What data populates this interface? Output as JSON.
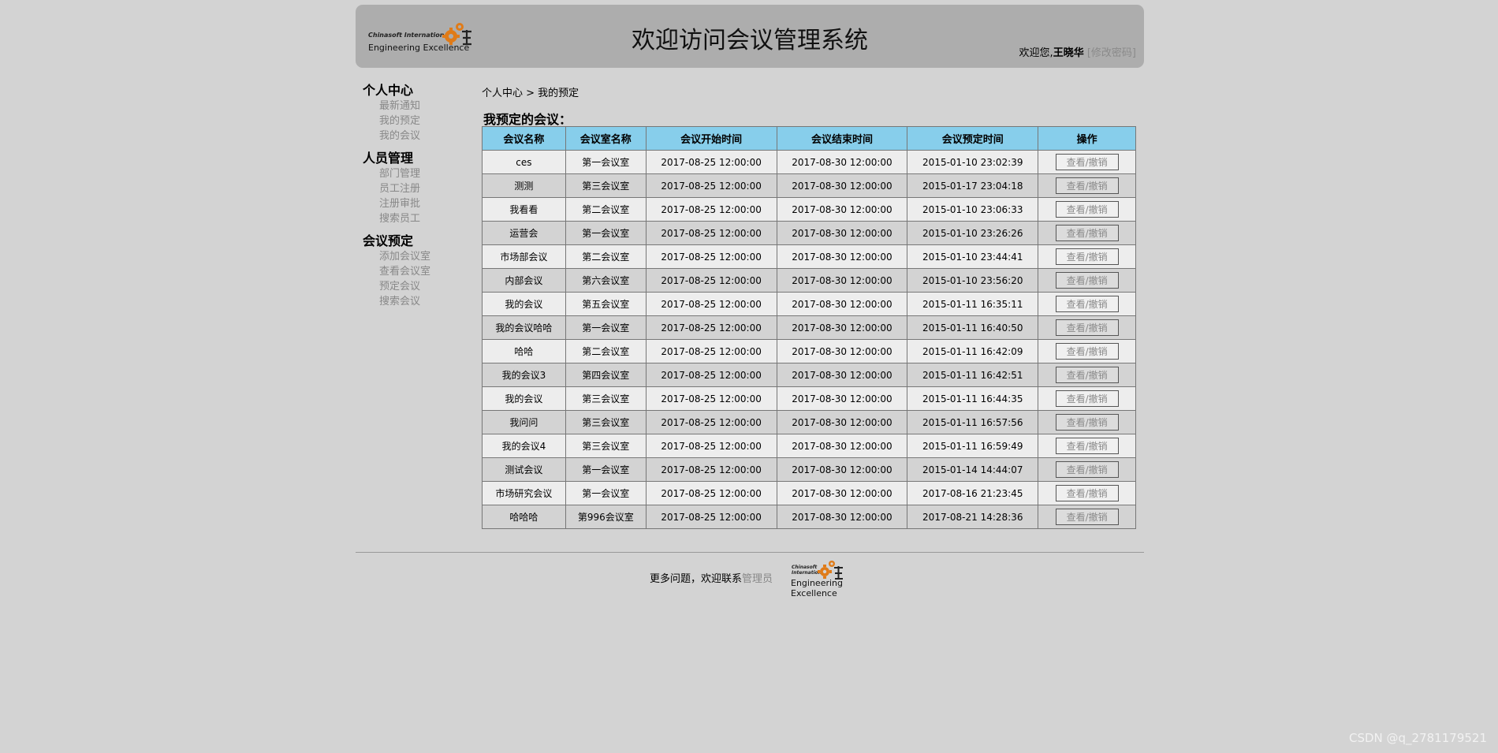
{
  "header": {
    "logo_line1": "Chinasoft International",
    "logo_line2": "Engineering Excellence",
    "title": "欢迎访问会议管理系统",
    "welcome_prefix": "欢迎您,",
    "user_name": "王晓华",
    "change_password": "[修改密码]"
  },
  "sidebar": {
    "groups": [
      {
        "title": "个人中心",
        "items": [
          "最新通知",
          "我的预定",
          "我的会议"
        ]
      },
      {
        "title": "人员管理",
        "items": [
          "部门管理",
          "员工注册",
          "注册审批",
          "搜索员工"
        ]
      },
      {
        "title": "会议预定",
        "items": [
          "添加会议室",
          "查看会议室",
          "预定会议",
          "搜索会议"
        ]
      }
    ]
  },
  "breadcrumb": "个人中心 > 我的预定",
  "section_title": "我预定的会议：",
  "table": {
    "headers": [
      "会议名称",
      "会议室名称",
      "会议开始时间",
      "会议结束时间",
      "会议预定时间",
      "操作"
    ],
    "action_label": "查看/撤销",
    "rows": [
      [
        "ces",
        "第一会议室",
        "2017-08-25 12:00:00",
        "2017-08-30 12:00:00",
        "2015-01-10 23:02:39"
      ],
      [
        "测测",
        "第三会议室",
        "2017-08-25 12:00:00",
        "2017-08-30 12:00:00",
        "2015-01-17 23:04:18"
      ],
      [
        "我看看",
        "第二会议室",
        "2017-08-25 12:00:00",
        "2017-08-30 12:00:00",
        "2015-01-10 23:06:33"
      ],
      [
        "运营会",
        "第一会议室",
        "2017-08-25 12:00:00",
        "2017-08-30 12:00:00",
        "2015-01-10 23:26:26"
      ],
      [
        "市场部会议",
        "第二会议室",
        "2017-08-25 12:00:00",
        "2017-08-30 12:00:00",
        "2015-01-10 23:44:41"
      ],
      [
        "内部会议",
        "第六会议室",
        "2017-08-25 12:00:00",
        "2017-08-30 12:00:00",
        "2015-01-10 23:56:20"
      ],
      [
        "我的会议",
        "第五会议室",
        "2017-08-25 12:00:00",
        "2017-08-30 12:00:00",
        "2015-01-11 16:35:11"
      ],
      [
        "我的会议哈哈",
        "第一会议室",
        "2017-08-25 12:00:00",
        "2017-08-30 12:00:00",
        "2015-01-11 16:40:50"
      ],
      [
        "哈哈",
        "第二会议室",
        "2017-08-25 12:00:00",
        "2017-08-30 12:00:00",
        "2015-01-11 16:42:09"
      ],
      [
        "我的会议3",
        "第四会议室",
        "2017-08-25 12:00:00",
        "2017-08-30 12:00:00",
        "2015-01-11 16:42:51"
      ],
      [
        "我的会议",
        "第三会议室",
        "2017-08-25 12:00:00",
        "2017-08-30 12:00:00",
        "2015-01-11 16:44:35"
      ],
      [
        "我问问",
        "第三会议室",
        "2017-08-25 12:00:00",
        "2017-08-30 12:00:00",
        "2015-01-11 16:57:56"
      ],
      [
        "我的会议4",
        "第三会议室",
        "2017-08-25 12:00:00",
        "2017-08-30 12:00:00",
        "2015-01-11 16:59:49"
      ],
      [
        "测试会议",
        "第一会议室",
        "2017-08-25 12:00:00",
        "2017-08-30 12:00:00",
        "2015-01-14 14:44:07"
      ],
      [
        "市场研究会议",
        "第一会议室",
        "2017-08-25 12:00:00",
        "2017-08-30 12:00:00",
        "2017-08-16 21:23:45"
      ],
      [
        "哈哈哈",
        "第996会议室",
        "2017-08-25 12:00:00",
        "2017-08-30 12:00:00",
        "2017-08-21 14:28:36"
      ]
    ]
  },
  "footer": {
    "text_prefix": "更多问题，欢迎联系",
    "admin_link": "管理员",
    "logo_line1a": "Chinasoft",
    "logo_line1b": "International",
    "logo_line2a": "Engineering",
    "logo_line2b": "Excellence"
  },
  "watermark": "CSDN @q_2781179521",
  "colors": {
    "page_bg": "#d3d3d3",
    "header_bg": "#adadad",
    "table_header_bg": "#87ceeb",
    "link_gray": "#888888",
    "gear_orange": "#e07b18"
  },
  "icons": {
    "logo_gear": "gear-icon"
  }
}
